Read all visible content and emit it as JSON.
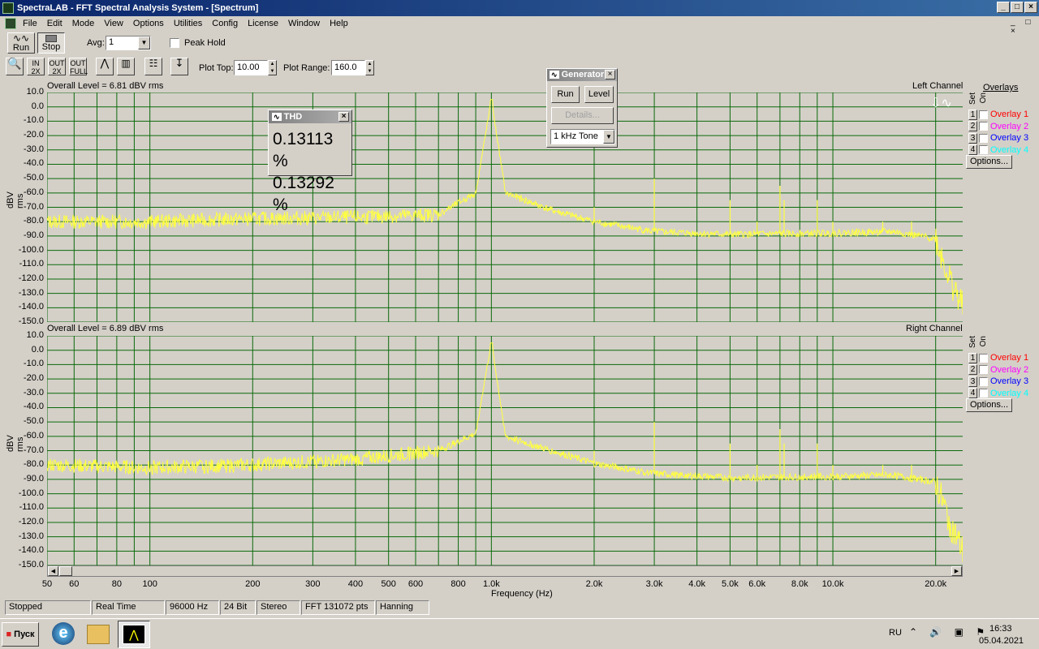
{
  "window": {
    "title": "SpectraLAB - FFT Spectral Analysis System - [Spectrum]"
  },
  "menu": [
    "File",
    "Edit",
    "Mode",
    "View",
    "Options",
    "Utilities",
    "Config",
    "License",
    "Window",
    "Help"
  ],
  "toolbar": {
    "run_label": "Run",
    "stop_label": "Stop",
    "avg_label": "Avg:",
    "avg_value": "1",
    "peak_hold_label": "Peak Hold",
    "plot_top_label": "Plot Top:",
    "plot_top_value": "10.00",
    "plot_range_label": "Plot Range:",
    "plot_range_value": "160.0",
    "zoom_in": "IN 2X",
    "zoom_out": "OUT 2X",
    "zoom_full": "OUT FULL"
  },
  "generator": {
    "title": "Generator",
    "run_label": "Run",
    "level_label": "Level",
    "details_label": "Details...",
    "tone_value": "1 kHz Tone"
  },
  "thd": {
    "title": "THD",
    "value1": "0.13113 %",
    "value2": "0.13292 %"
  },
  "left_panel": {
    "overall": "Overall Level = 6.81 dBV rms",
    "channel": "Left Channel"
  },
  "right_panel": {
    "overall": "Overall Level = 6.89 dBV rms",
    "channel": "Right Channel"
  },
  "overlays": {
    "header": "Overlays",
    "set_label": "Set",
    "on_label": "On",
    "options_label": "Options...",
    "items": [
      {
        "num": "1",
        "label": "Overlay 1",
        "color": "#ff0000"
      },
      {
        "num": "2",
        "label": "Overlay 2",
        "color": "#ff00ff"
      },
      {
        "num": "3",
        "label": "Overlay 3",
        "color": "#0000ff"
      },
      {
        "num": "4",
        "label": "Overlay 4",
        "color": "#00ffff"
      }
    ]
  },
  "axes": {
    "ylabel": "dBV rms",
    "xlabel": "Frequency (Hz)",
    "y_ticks": [
      "10.0",
      "0.0",
      "-10.0",
      "-20.0",
      "-30.0",
      "-40.0",
      "-50.0",
      "-60.0",
      "-70.0",
      "-80.0",
      "-90.0",
      "-100.0",
      "-110.0",
      "-120.0",
      "-130.0",
      "-140.0",
      "-150.0"
    ],
    "x_ticks": [
      {
        "label": "50",
        "f": 50
      },
      {
        "label": "60",
        "f": 60
      },
      {
        "label": "80",
        "f": 80
      },
      {
        "label": "100",
        "f": 100
      },
      {
        "label": "200",
        "f": 200
      },
      {
        "label": "300",
        "f": 300
      },
      {
        "label": "400",
        "f": 400
      },
      {
        "label": "500",
        "f": 500
      },
      {
        "label": "600",
        "f": 600
      },
      {
        "label": "800",
        "f": 800
      },
      {
        "label": "1.0k",
        "f": 1000
      },
      {
        "label": "2.0k",
        "f": 2000
      },
      {
        "label": "3.0k",
        "f": 3000
      },
      {
        "label": "4.0k",
        "f": 4000
      },
      {
        "label": "5.0k",
        "f": 5000
      },
      {
        "label": "6.0k",
        "f": 6000
      },
      {
        "label": "8.0k",
        "f": 8000
      },
      {
        "label": "10.0k",
        "f": 10000
      },
      {
        "label": "20.0k",
        "f": 20000
      }
    ]
  },
  "chart_data": [
    {
      "type": "line",
      "xlabel": "Frequency (Hz)",
      "ylabel": "dBV rms",
      "xscale": "log",
      "xlim": [
        50,
        24000
      ],
      "ylim": [
        -150,
        10
      ],
      "grid": true,
      "trace_color": "#ffff40",
      "series": [
        {
          "x": [
            50,
            100,
            200,
            400,
            700,
            900,
            1000,
            1100,
            1500,
            2000,
            3000,
            5000,
            10000,
            15000,
            20000,
            22000,
            24000
          ],
          "y": [
            -80,
            -80,
            -78,
            -77,
            -75,
            -60,
            5,
            -60,
            -72,
            -80,
            -87,
            -89,
            -88,
            -87,
            -92,
            -120,
            -140
          ]
        }
      ]
    },
    {
      "type": "line",
      "xlabel": "Frequency (Hz)",
      "ylabel": "dBV rms",
      "xscale": "log",
      "xlim": [
        50,
        24000
      ],
      "ylim": [
        -150,
        10
      ],
      "grid": true,
      "trace_color": "#ffff40",
      "series": [
        {
          "x": [
            50,
            100,
            200,
            400,
            700,
            900,
            1000,
            1100,
            1500,
            2000,
            3000,
            5000,
            10000,
            15000,
            20000,
            22000,
            24000
          ],
          "y": [
            -80,
            -82,
            -80,
            -76,
            -70,
            -58,
            6,
            -60,
            -70,
            -79,
            -86,
            -89,
            -88,
            -87,
            -92,
            -120,
            -140
          ]
        }
      ]
    }
  ],
  "status": [
    "Stopped",
    "Real Time",
    "96000 Hz",
    "24 Bit",
    "Stereo",
    "FFT 131072 pts",
    "Hanning"
  ],
  "taskbar": {
    "start_label": "Пуск",
    "lang": "RU",
    "time": "16:33",
    "date": "05.04.2021"
  }
}
